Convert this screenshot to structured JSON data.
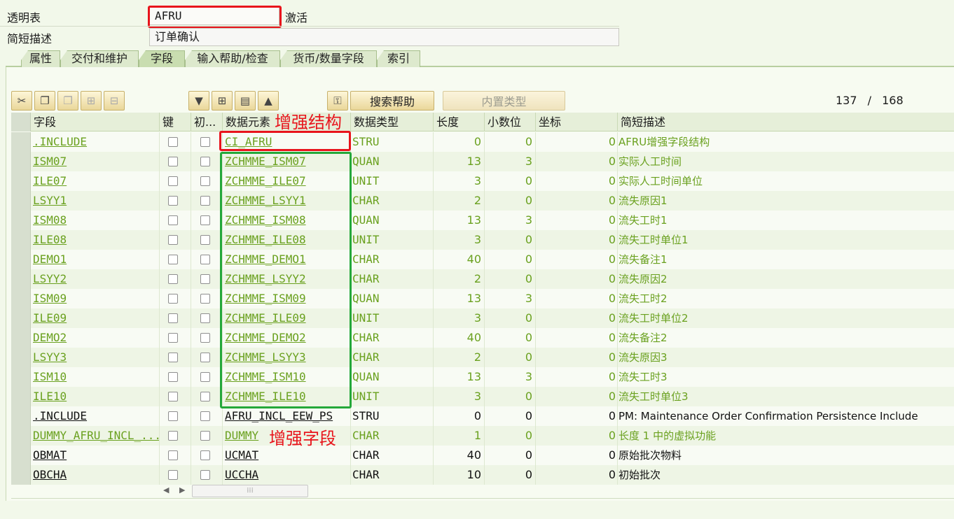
{
  "header": {
    "table_type_label": "透明表",
    "table_name": "AFRU",
    "status": "激活",
    "short_desc_label": "简短描述",
    "short_desc": "订单确认"
  },
  "tabs": [
    {
      "label": "属性"
    },
    {
      "label": "交付和维护"
    },
    {
      "label": "字段"
    },
    {
      "label": "输入帮助/检查"
    },
    {
      "label": "货币/数量字段"
    },
    {
      "label": "索引"
    }
  ],
  "toolbar": {
    "icons": [
      "cut-icon",
      "copy-icon",
      "paste-icon",
      "insert-row-icon",
      "delete-row-icon",
      "filter-icon",
      "insert-icon",
      "clipboard-icon",
      "move-up-icon",
      "key-icon"
    ],
    "search_help": "搜索帮助",
    "builtin_type": "内置类型",
    "position": "137",
    "separator": "/",
    "total": "168"
  },
  "columns": [
    "字段",
    "键",
    "初...",
    "数据元素",
    "数据类型",
    "长度",
    "小数位",
    "坐标",
    "简短描述"
  ],
  "annotations": {
    "enhancement_structure": "增强结构",
    "enhancement_field": "增强字段"
  },
  "rows": [
    {
      "field": ".INCLUDE",
      "de": "CI_AFRU",
      "type": "STRU",
      "len": "0",
      "dec": "0",
      "coord": "0",
      "desc": "AFRU增强字段结构",
      "color": "green"
    },
    {
      "field": "ISM07",
      "de": "ZCHMME_ISM07",
      "type": "QUAN",
      "len": "13",
      "dec": "3",
      "coord": "0",
      "desc": "实际人工时间",
      "color": "green"
    },
    {
      "field": "ILE07",
      "de": "ZCHMME_ILE07",
      "type": "UNIT",
      "len": "3",
      "dec": "0",
      "coord": "0",
      "desc": "实际人工时间单位",
      "color": "green"
    },
    {
      "field": "LSYY1",
      "de": "ZCHMME_LSYY1",
      "type": "CHAR",
      "len": "2",
      "dec": "0",
      "coord": "0",
      "desc": "流失原因1",
      "color": "green"
    },
    {
      "field": "ISM08",
      "de": "ZCHMME_ISM08",
      "type": "QUAN",
      "len": "13",
      "dec": "3",
      "coord": "0",
      "desc": "流失工时1",
      "color": "green"
    },
    {
      "field": "ILE08",
      "de": "ZCHMME_ILE08",
      "type": "UNIT",
      "len": "3",
      "dec": "0",
      "coord": "0",
      "desc": "流失工时单位1",
      "color": "green"
    },
    {
      "field": "DEMO1",
      "de": "ZCHMME_DEMO1",
      "type": "CHAR",
      "len": "40",
      "dec": "0",
      "coord": "0",
      "desc": "流失备注1",
      "color": "green"
    },
    {
      "field": "LSYY2",
      "de": "ZCHMME_LSYY2",
      "type": "CHAR",
      "len": "2",
      "dec": "0",
      "coord": "0",
      "desc": "流失原因2",
      "color": "green"
    },
    {
      "field": "ISM09",
      "de": "ZCHMME_ISM09",
      "type": "QUAN",
      "len": "13",
      "dec": "3",
      "coord": "0",
      "desc": "流失工时2",
      "color": "green"
    },
    {
      "field": "ILE09",
      "de": "ZCHMME_ILE09",
      "type": "UNIT",
      "len": "3",
      "dec": "0",
      "coord": "0",
      "desc": "流失工时单位2",
      "color": "green"
    },
    {
      "field": "DEMO2",
      "de": "ZCHMME_DEMO2",
      "type": "CHAR",
      "len": "40",
      "dec": "0",
      "coord": "0",
      "desc": "流失备注2",
      "color": "green"
    },
    {
      "field": "LSYY3",
      "de": "ZCHMME_LSYY3",
      "type": "CHAR",
      "len": "2",
      "dec": "0",
      "coord": "0",
      "desc": "流失原因3",
      "color": "green"
    },
    {
      "field": "ISM10",
      "de": "ZCHMME_ISM10",
      "type": "QUAN",
      "len": "13",
      "dec": "3",
      "coord": "0",
      "desc": "流失工时3",
      "color": "green"
    },
    {
      "field": "ILE10",
      "de": "ZCHMME_ILE10",
      "type": "UNIT",
      "len": "3",
      "dec": "0",
      "coord": "0",
      "desc": "流失工时单位3",
      "color": "green"
    },
    {
      "field": ".INCLUDE",
      "de": "AFRU_INCL_EEW_PS",
      "type": "STRU",
      "len": "0",
      "dec": "0",
      "coord": "0",
      "desc": "PM: Maintenance Order Confirmation Persistence Include",
      "color": "black"
    },
    {
      "field": "DUMMY_AFRU_INCL_...",
      "de": "DUMMY",
      "type": "CHAR",
      "len": "1",
      "dec": "0",
      "coord": "0",
      "desc": "长度 1 中的虚拟功能",
      "color": "green"
    },
    {
      "field": "OBMAT",
      "de": "UCMAT",
      "type": "CHAR",
      "len": "40",
      "dec": "0",
      "coord": "0",
      "desc": "原始批次物料",
      "color": "black"
    },
    {
      "field": "OBCHA",
      "de": "UCCHA",
      "type": "CHAR",
      "len": "10",
      "dec": "0",
      "coord": "0",
      "desc": "初始批次",
      "color": "black"
    }
  ]
}
